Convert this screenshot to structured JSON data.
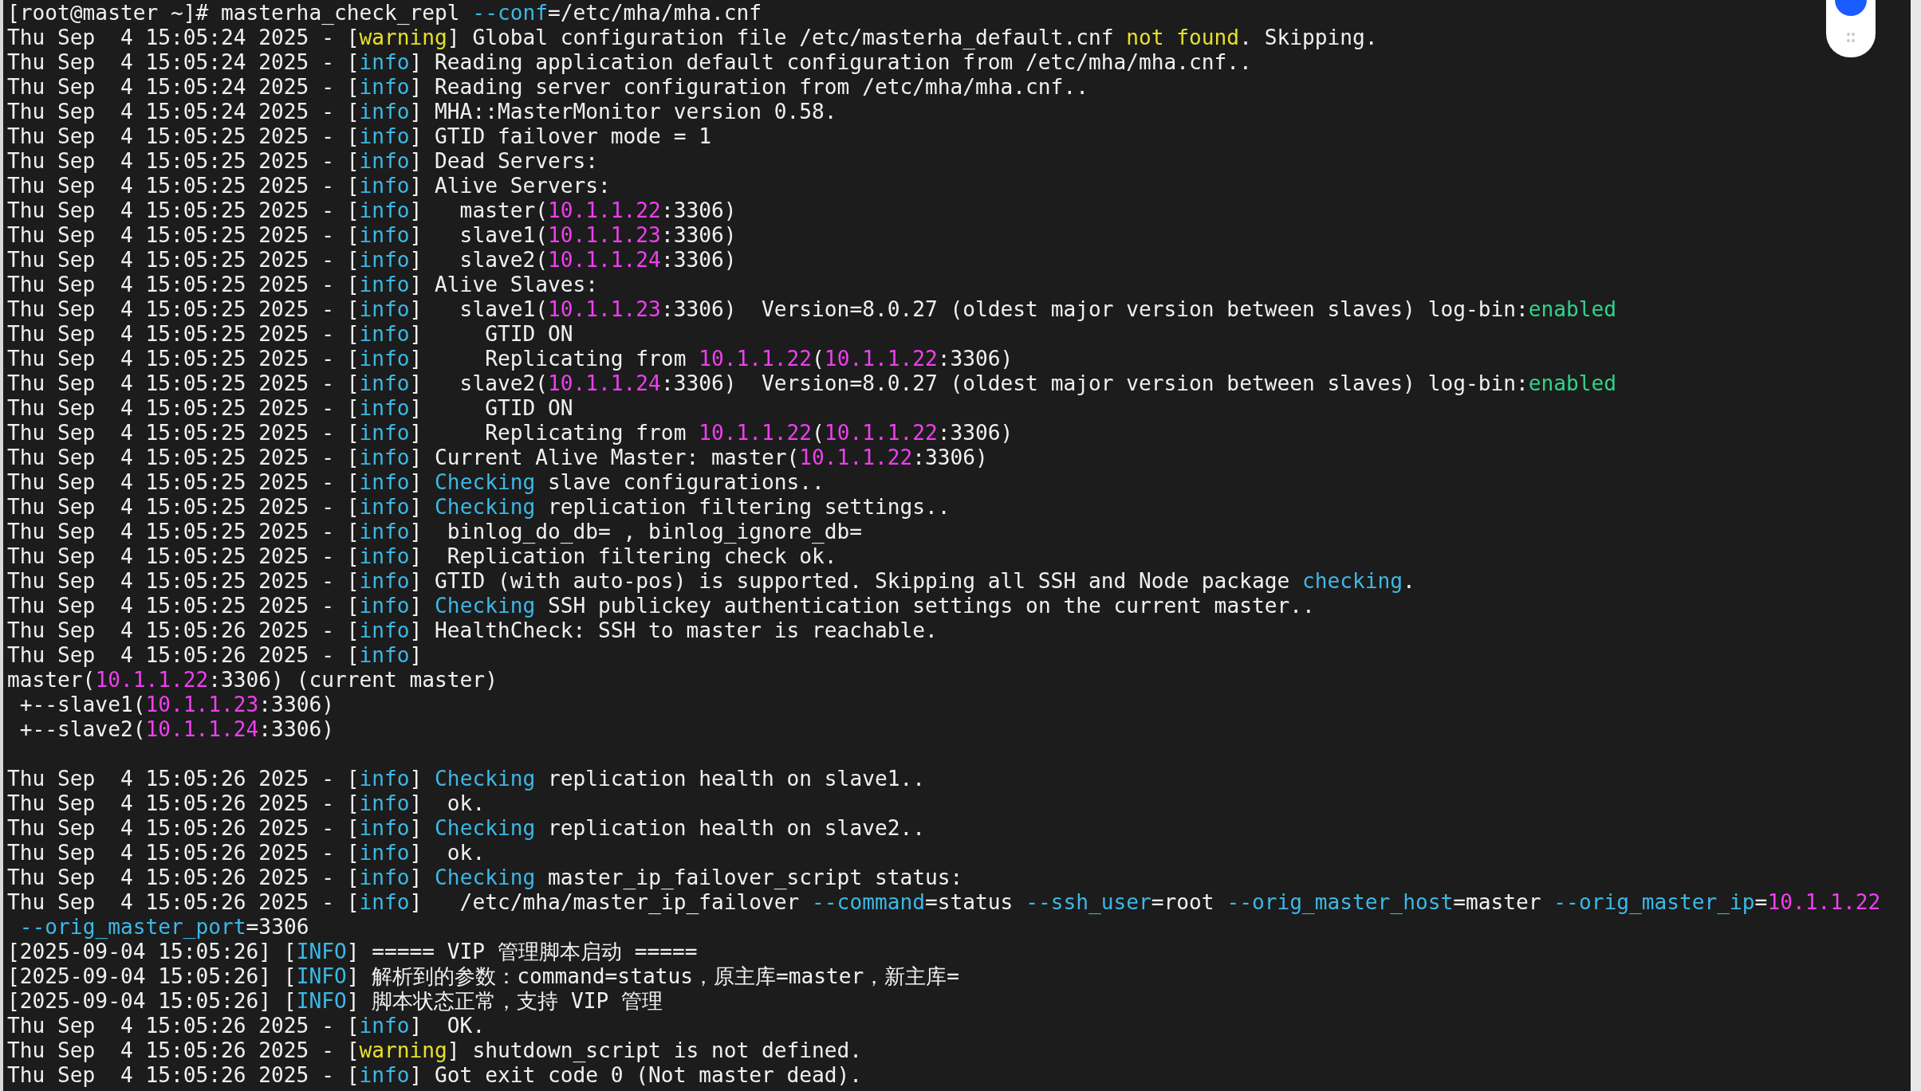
{
  "terminal": {
    "lines": [
      {
        "kind": "text",
        "segments": [
          {
            "kind": "plain",
            "text": "[root@master ~]# masterha_check_repl "
          },
          {
            "kind": "option",
            "text": "--conf"
          },
          {
            "kind": "plain",
            "text": "=/etc/mha/mha.cnf"
          }
        ]
      },
      {
        "kind": "text",
        "segments": [
          {
            "kind": "plain",
            "text": "Thu Sep  4 15:05:24 2025 - ["
          },
          {
            "kind": "warning",
            "text": "warning"
          },
          {
            "kind": "plain",
            "text": "] Global configuration file /etc/masterha_default.cnf "
          },
          {
            "kind": "warning",
            "text": "not found"
          },
          {
            "kind": "plain",
            "text": ". Skipping."
          }
        ]
      },
      {
        "kind": "text",
        "segments": [
          {
            "kind": "plain",
            "text": "Thu Sep  4 15:05:24 2025 - ["
          },
          {
            "kind": "keyword",
            "text": "info"
          },
          {
            "kind": "plain",
            "text": "] Reading application default configuration from /etc/mha/mha.cnf.."
          }
        ]
      },
      {
        "kind": "text",
        "segments": [
          {
            "kind": "plain",
            "text": "Thu Sep  4 15:05:24 2025 - ["
          },
          {
            "kind": "keyword",
            "text": "info"
          },
          {
            "kind": "plain",
            "text": "] Reading server configuration from /etc/mha/mha.cnf.."
          }
        ]
      },
      {
        "kind": "text",
        "segments": [
          {
            "kind": "plain",
            "text": "Thu Sep  4 15:05:24 2025 - ["
          },
          {
            "kind": "keyword",
            "text": "info"
          },
          {
            "kind": "plain",
            "text": "] MHA::MasterMonitor version 0.58."
          }
        ]
      },
      {
        "kind": "text",
        "segments": [
          {
            "kind": "plain",
            "text": "Thu Sep  4 15:05:25 2025 - ["
          },
          {
            "kind": "keyword",
            "text": "info"
          },
          {
            "kind": "plain",
            "text": "] GTID failover mode = 1"
          }
        ]
      },
      {
        "kind": "text",
        "segments": [
          {
            "kind": "plain",
            "text": "Thu Sep  4 15:05:25 2025 - ["
          },
          {
            "kind": "keyword",
            "text": "info"
          },
          {
            "kind": "plain",
            "text": "] Dead Servers:"
          }
        ]
      },
      {
        "kind": "text",
        "segments": [
          {
            "kind": "plain",
            "text": "Thu Sep  4 15:05:25 2025 - ["
          },
          {
            "kind": "keyword",
            "text": "info"
          },
          {
            "kind": "plain",
            "text": "] Alive Servers:"
          }
        ]
      },
      {
        "kind": "text",
        "segments": [
          {
            "kind": "plain",
            "text": "Thu Sep  4 15:05:25 2025 - ["
          },
          {
            "kind": "keyword",
            "text": "info"
          },
          {
            "kind": "plain",
            "text": "]   master("
          },
          {
            "kind": "address",
            "text": "10.1.1.22"
          },
          {
            "kind": "plain",
            "text": ":3306)"
          }
        ]
      },
      {
        "kind": "text",
        "segments": [
          {
            "kind": "plain",
            "text": "Thu Sep  4 15:05:25 2025 - ["
          },
          {
            "kind": "keyword",
            "text": "info"
          },
          {
            "kind": "plain",
            "text": "]   slave1("
          },
          {
            "kind": "address",
            "text": "10.1.1.23"
          },
          {
            "kind": "plain",
            "text": ":3306)"
          }
        ]
      },
      {
        "kind": "text",
        "segments": [
          {
            "kind": "plain",
            "text": "Thu Sep  4 15:05:25 2025 - ["
          },
          {
            "kind": "keyword",
            "text": "info"
          },
          {
            "kind": "plain",
            "text": "]   slave2("
          },
          {
            "kind": "address",
            "text": "10.1.1.24"
          },
          {
            "kind": "plain",
            "text": ":3306)"
          }
        ]
      },
      {
        "kind": "text",
        "segments": [
          {
            "kind": "plain",
            "text": "Thu Sep  4 15:05:25 2025 - ["
          },
          {
            "kind": "keyword",
            "text": "info"
          },
          {
            "kind": "plain",
            "text": "] Alive Slaves:"
          }
        ]
      },
      {
        "kind": "text",
        "segments": [
          {
            "kind": "plain",
            "text": "Thu Sep  4 15:05:25 2025 - ["
          },
          {
            "kind": "keyword",
            "text": "info"
          },
          {
            "kind": "plain",
            "text": "]   slave1("
          },
          {
            "kind": "address",
            "text": "10.1.1.23"
          },
          {
            "kind": "plain",
            "text": ":3306)  Version=8.0.27 (oldest major version between slaves) log-bin:"
          },
          {
            "kind": "enabled",
            "text": "enabled"
          }
        ]
      },
      {
        "kind": "text",
        "segments": [
          {
            "kind": "plain",
            "text": "Thu Sep  4 15:05:25 2025 - ["
          },
          {
            "kind": "keyword",
            "text": "info"
          },
          {
            "kind": "plain",
            "text": "]     GTID ON"
          }
        ]
      },
      {
        "kind": "text",
        "segments": [
          {
            "kind": "plain",
            "text": "Thu Sep  4 15:05:25 2025 - ["
          },
          {
            "kind": "keyword",
            "text": "info"
          },
          {
            "kind": "plain",
            "text": "]     Replicating from "
          },
          {
            "kind": "address",
            "text": "10.1.1.22"
          },
          {
            "kind": "plain",
            "text": "("
          },
          {
            "kind": "address",
            "text": "10.1.1.22"
          },
          {
            "kind": "plain",
            "text": ":3306)"
          }
        ]
      },
      {
        "kind": "text",
        "segments": [
          {
            "kind": "plain",
            "text": "Thu Sep  4 15:05:25 2025 - ["
          },
          {
            "kind": "keyword",
            "text": "info"
          },
          {
            "kind": "plain",
            "text": "]   slave2("
          },
          {
            "kind": "address",
            "text": "10.1.1.24"
          },
          {
            "kind": "plain",
            "text": ":3306)  Version=8.0.27 (oldest major version between slaves) log-bin:"
          },
          {
            "kind": "enabled",
            "text": "enabled"
          }
        ]
      },
      {
        "kind": "text",
        "segments": [
          {
            "kind": "plain",
            "text": "Thu Sep  4 15:05:25 2025 - ["
          },
          {
            "kind": "keyword",
            "text": "info"
          },
          {
            "kind": "plain",
            "text": "]     GTID ON"
          }
        ]
      },
      {
        "kind": "text",
        "segments": [
          {
            "kind": "plain",
            "text": "Thu Sep  4 15:05:25 2025 - ["
          },
          {
            "kind": "keyword",
            "text": "info"
          },
          {
            "kind": "plain",
            "text": "]     Replicating from "
          },
          {
            "kind": "address",
            "text": "10.1.1.22"
          },
          {
            "kind": "plain",
            "text": "("
          },
          {
            "kind": "address",
            "text": "10.1.1.22"
          },
          {
            "kind": "plain",
            "text": ":3306)"
          }
        ]
      },
      {
        "kind": "text",
        "segments": [
          {
            "kind": "plain",
            "text": "Thu Sep  4 15:05:25 2025 - ["
          },
          {
            "kind": "keyword",
            "text": "info"
          },
          {
            "kind": "plain",
            "text": "] Current Alive Master: master("
          },
          {
            "kind": "address",
            "text": "10.1.1.22"
          },
          {
            "kind": "plain",
            "text": ":3306)"
          }
        ]
      },
      {
        "kind": "text",
        "segments": [
          {
            "kind": "plain",
            "text": "Thu Sep  4 15:05:25 2025 - ["
          },
          {
            "kind": "keyword",
            "text": "info"
          },
          {
            "kind": "plain",
            "text": "] "
          },
          {
            "kind": "keyword",
            "text": "Checking"
          },
          {
            "kind": "plain",
            "text": " slave configurations.."
          }
        ]
      },
      {
        "kind": "text",
        "segments": [
          {
            "kind": "plain",
            "text": "Thu Sep  4 15:05:25 2025 - ["
          },
          {
            "kind": "keyword",
            "text": "info"
          },
          {
            "kind": "plain",
            "text": "] "
          },
          {
            "kind": "keyword",
            "text": "Checking"
          },
          {
            "kind": "plain",
            "text": " replication filtering settings.."
          }
        ]
      },
      {
        "kind": "text",
        "segments": [
          {
            "kind": "plain",
            "text": "Thu Sep  4 15:05:25 2025 - ["
          },
          {
            "kind": "keyword",
            "text": "info"
          },
          {
            "kind": "plain",
            "text": "]  binlog_do_db= , binlog_ignore_db="
          }
        ]
      },
      {
        "kind": "text",
        "segments": [
          {
            "kind": "plain",
            "text": "Thu Sep  4 15:05:25 2025 - ["
          },
          {
            "kind": "keyword",
            "text": "info"
          },
          {
            "kind": "plain",
            "text": "]  Replication filtering check ok."
          }
        ]
      },
      {
        "kind": "text",
        "segments": [
          {
            "kind": "plain",
            "text": "Thu Sep  4 15:05:25 2025 - ["
          },
          {
            "kind": "keyword",
            "text": "info"
          },
          {
            "kind": "plain",
            "text": "] GTID (with auto-pos) is supported. Skipping all SSH and Node package "
          },
          {
            "kind": "keyword",
            "text": "checking"
          },
          {
            "kind": "plain",
            "text": "."
          }
        ]
      },
      {
        "kind": "text",
        "segments": [
          {
            "kind": "plain",
            "text": "Thu Sep  4 15:05:25 2025 - ["
          },
          {
            "kind": "keyword",
            "text": "info"
          },
          {
            "kind": "plain",
            "text": "] "
          },
          {
            "kind": "keyword",
            "text": "Checking"
          },
          {
            "kind": "plain",
            "text": " SSH publickey authentication settings on the current master.."
          }
        ]
      },
      {
        "kind": "text",
        "segments": [
          {
            "kind": "plain",
            "text": "Thu Sep  4 15:05:26 2025 - ["
          },
          {
            "kind": "keyword",
            "text": "info"
          },
          {
            "kind": "plain",
            "text": "] HealthCheck: SSH to master is reachable."
          }
        ]
      },
      {
        "kind": "text",
        "segments": [
          {
            "kind": "plain",
            "text": "Thu Sep  4 15:05:26 2025 - ["
          },
          {
            "kind": "keyword",
            "text": "info"
          },
          {
            "kind": "plain",
            "text": "]"
          }
        ]
      },
      {
        "kind": "text",
        "segments": [
          {
            "kind": "plain",
            "text": "master("
          },
          {
            "kind": "address",
            "text": "10.1.1.22"
          },
          {
            "kind": "plain",
            "text": ":3306) (current master)"
          }
        ]
      },
      {
        "kind": "text",
        "segments": [
          {
            "kind": "plain",
            "text": " +--slave1("
          },
          {
            "kind": "address",
            "text": "10.1.1.23"
          },
          {
            "kind": "plain",
            "text": ":3306)"
          }
        ]
      },
      {
        "kind": "text",
        "segments": [
          {
            "kind": "plain",
            "text": " +--slave2("
          },
          {
            "kind": "address",
            "text": "10.1.1.24"
          },
          {
            "kind": "plain",
            "text": ":3306)"
          }
        ]
      },
      {
        "kind": "blank"
      },
      {
        "kind": "text",
        "segments": [
          {
            "kind": "plain",
            "text": "Thu Sep  4 15:05:26 2025 - ["
          },
          {
            "kind": "keyword",
            "text": "info"
          },
          {
            "kind": "plain",
            "text": "] "
          },
          {
            "kind": "keyword",
            "text": "Checking"
          },
          {
            "kind": "plain",
            "text": " replication health on slave1.."
          }
        ]
      },
      {
        "kind": "text",
        "segments": [
          {
            "kind": "plain",
            "text": "Thu Sep  4 15:05:26 2025 - ["
          },
          {
            "kind": "keyword",
            "text": "info"
          },
          {
            "kind": "plain",
            "text": "]  ok."
          }
        ]
      },
      {
        "kind": "text",
        "segments": [
          {
            "kind": "plain",
            "text": "Thu Sep  4 15:05:26 2025 - ["
          },
          {
            "kind": "keyword",
            "text": "info"
          },
          {
            "kind": "plain",
            "text": "] "
          },
          {
            "kind": "keyword",
            "text": "Checking"
          },
          {
            "kind": "plain",
            "text": " replication health on slave2.."
          }
        ]
      },
      {
        "kind": "text",
        "segments": [
          {
            "kind": "plain",
            "text": "Thu Sep  4 15:05:26 2025 - ["
          },
          {
            "kind": "keyword",
            "text": "info"
          },
          {
            "kind": "plain",
            "text": "]  ok."
          }
        ]
      },
      {
        "kind": "text",
        "segments": [
          {
            "kind": "plain",
            "text": "Thu Sep  4 15:05:26 2025 - ["
          },
          {
            "kind": "keyword",
            "text": "info"
          },
          {
            "kind": "plain",
            "text": "] "
          },
          {
            "kind": "keyword",
            "text": "Checking"
          },
          {
            "kind": "plain",
            "text": " master_ip_failover_script status:"
          }
        ]
      },
      {
        "kind": "text",
        "segments": [
          {
            "kind": "plain",
            "text": "Thu Sep  4 15:05:26 2025 - ["
          },
          {
            "kind": "keyword",
            "text": "info"
          },
          {
            "kind": "plain",
            "text": "]   /etc/mha/master_ip_failover "
          },
          {
            "kind": "option",
            "text": "--command"
          },
          {
            "kind": "plain",
            "text": "=status "
          },
          {
            "kind": "option",
            "text": "--ssh_user"
          },
          {
            "kind": "plain",
            "text": "=root "
          },
          {
            "kind": "option",
            "text": "--orig_master_host"
          },
          {
            "kind": "plain",
            "text": "=master "
          },
          {
            "kind": "option",
            "text": "--orig_master_ip"
          },
          {
            "kind": "plain",
            "text": "="
          },
          {
            "kind": "address",
            "text": "10.1.1.22"
          }
        ]
      },
      {
        "kind": "wrapped",
        "segments": [
          {
            "kind": "option",
            "text": "--orig_master_port"
          },
          {
            "kind": "plain",
            "text": "=3306"
          }
        ]
      },
      {
        "kind": "text",
        "segments": [
          {
            "kind": "plain",
            "text": "[2025-09-04 15:05:26] ["
          },
          {
            "kind": "keyword",
            "text": "INFO"
          },
          {
            "kind": "plain",
            "text": "] ===== VIP 管理脚本启动 ====="
          }
        ]
      },
      {
        "kind": "text",
        "segments": [
          {
            "kind": "plain",
            "text": "[2025-09-04 15:05:26] ["
          },
          {
            "kind": "keyword",
            "text": "INFO"
          },
          {
            "kind": "plain",
            "text": "] 解析到的参数：command=status，原主库=master，新主库="
          }
        ]
      },
      {
        "kind": "text",
        "segments": [
          {
            "kind": "plain",
            "text": "[2025-09-04 15:05:26] ["
          },
          {
            "kind": "keyword",
            "text": "INFO"
          },
          {
            "kind": "plain",
            "text": "] 脚本状态正常，支持 VIP 管理"
          }
        ]
      },
      {
        "kind": "text",
        "segments": [
          {
            "kind": "plain",
            "text": "Thu Sep  4 15:05:26 2025 - ["
          },
          {
            "kind": "keyword",
            "text": "info"
          },
          {
            "kind": "plain",
            "text": "]  OK."
          }
        ]
      },
      {
        "kind": "text",
        "segments": [
          {
            "kind": "plain",
            "text": "Thu Sep  4 15:05:26 2025 - ["
          },
          {
            "kind": "warning",
            "text": "warning"
          },
          {
            "kind": "plain",
            "text": "] shutdown_script is not defined."
          }
        ]
      },
      {
        "kind": "text",
        "segments": [
          {
            "kind": "plain",
            "text": "Thu Sep  4 15:05:26 2025 - ["
          },
          {
            "kind": "keyword",
            "text": "info"
          },
          {
            "kind": "plain",
            "text": "] Got exit code 0 (Not master dead)."
          }
        ]
      }
    ]
  }
}
